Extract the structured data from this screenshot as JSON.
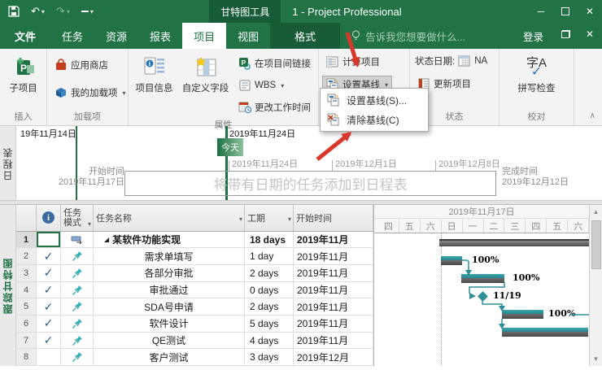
{
  "icons": {
    "dropdown": "▾",
    "undo": "↶",
    "redo": "↷",
    "qat_more": "≡",
    "minimize": "─",
    "close": "✕",
    "chevron_up": "∧",
    "expand_triangle": "◢",
    "check": "✓",
    "info": "i",
    "scroll_up": "▲",
    "scroll_down": "▼"
  },
  "titlebar": {
    "context_tool": "甘特图工具",
    "title": "1 - Project Professional"
  },
  "tabs": {
    "items": [
      "文件",
      "任务",
      "资源",
      "报表",
      "项目",
      "视图"
    ],
    "active": "项目",
    "contextual": "格式",
    "tell_me": "告诉我您想要做什么...",
    "sign_in": "登录"
  },
  "ribbon": {
    "insert": {
      "group_label": "插入",
      "subproject": "子项目"
    },
    "addins": {
      "group_label": "加载项",
      "store": "应用商店",
      "my_addins": "我的加载项"
    },
    "properties": {
      "group_label": "属性",
      "project_info": "项目信息",
      "custom_fields": "自定义字段",
      "link_projects": "在项目间链接",
      "wbs": "WBS",
      "change_working_time": "更改工作时间"
    },
    "schedule": {
      "calculate": "计算项目",
      "set_baseline": "设置基线"
    },
    "status": {
      "group_label": "状态",
      "status_date": "状态日期:",
      "status_value": "NA",
      "update_project": "更新项目"
    },
    "proofing": {
      "group_label": "校对",
      "glyph": "字A",
      "spelling": "拼写检查"
    }
  },
  "baseline_menu": {
    "set": "设置基线(S)...",
    "clear": "清除基线(C)"
  },
  "timeline": {
    "sidebar": "日程表",
    "date_left": "19年11月14日",
    "today_date": "2019年11月24日",
    "today_label": "今天",
    "ticks": [
      "2019年11月24日",
      "2019年12月1日",
      "2019年12月8日"
    ],
    "start_label": "开始时间",
    "start_date": "2019年11月17日",
    "finish_label": "完成时间",
    "finish_date": "2019年12月12日",
    "placeholder": "将带有日期的任务添加到日程表"
  },
  "gantt": {
    "sidebar": "跟踪甘特图",
    "table": {
      "headers": {
        "mode": "任务模式",
        "name": "任务名称",
        "duration": "工期",
        "start": "开始时间"
      },
      "rows": [
        {
          "num": "1",
          "check": "",
          "name": "某软件功能实现",
          "duration": "18 days",
          "start": "2019年11月"
        },
        {
          "num": "2",
          "check": "✓",
          "name": "需求单填写",
          "duration": "1 day",
          "start": "2019年11月"
        },
        {
          "num": "3",
          "check": "✓",
          "name": "各部分审批",
          "duration": "2 days",
          "start": "2019年11月"
        },
        {
          "num": "4",
          "check": "✓",
          "name": "审批通过",
          "duration": "0 days",
          "start": "2019年11月"
        },
        {
          "num": "5",
          "check": "✓",
          "name": "SDA号申请",
          "duration": "2 days",
          "start": "2019年11月"
        },
        {
          "num": "6",
          "check": "✓",
          "name": "软件设计",
          "duration": "5 days",
          "start": "2019年11月"
        },
        {
          "num": "7",
          "check": "✓",
          "name": "QE测试",
          "duration": "4 days",
          "start": "2019年11月"
        },
        {
          "num": "8",
          "check": "",
          "name": "客户测试",
          "duration": "3 days",
          "start": "2019年12月"
        }
      ]
    },
    "chart": {
      "week_label": "2019年11月17日",
      "days": [
        "四",
        "五",
        "六",
        "日",
        "一",
        "二",
        "三",
        "四",
        "五",
        "六"
      ],
      "labels": {
        "task2": "100%",
        "task3": "100%",
        "milestone": "11/19",
        "task5": "100%"
      }
    }
  },
  "colors": {
    "app_green": "#217346",
    "contextual_green": "#185c37",
    "today_green": "#1e7145",
    "bar_teal": "#2d9099",
    "bar_grey": "#4a4a4a",
    "annotation_red": "#d8372b",
    "check_blue": "#2d5986"
  }
}
